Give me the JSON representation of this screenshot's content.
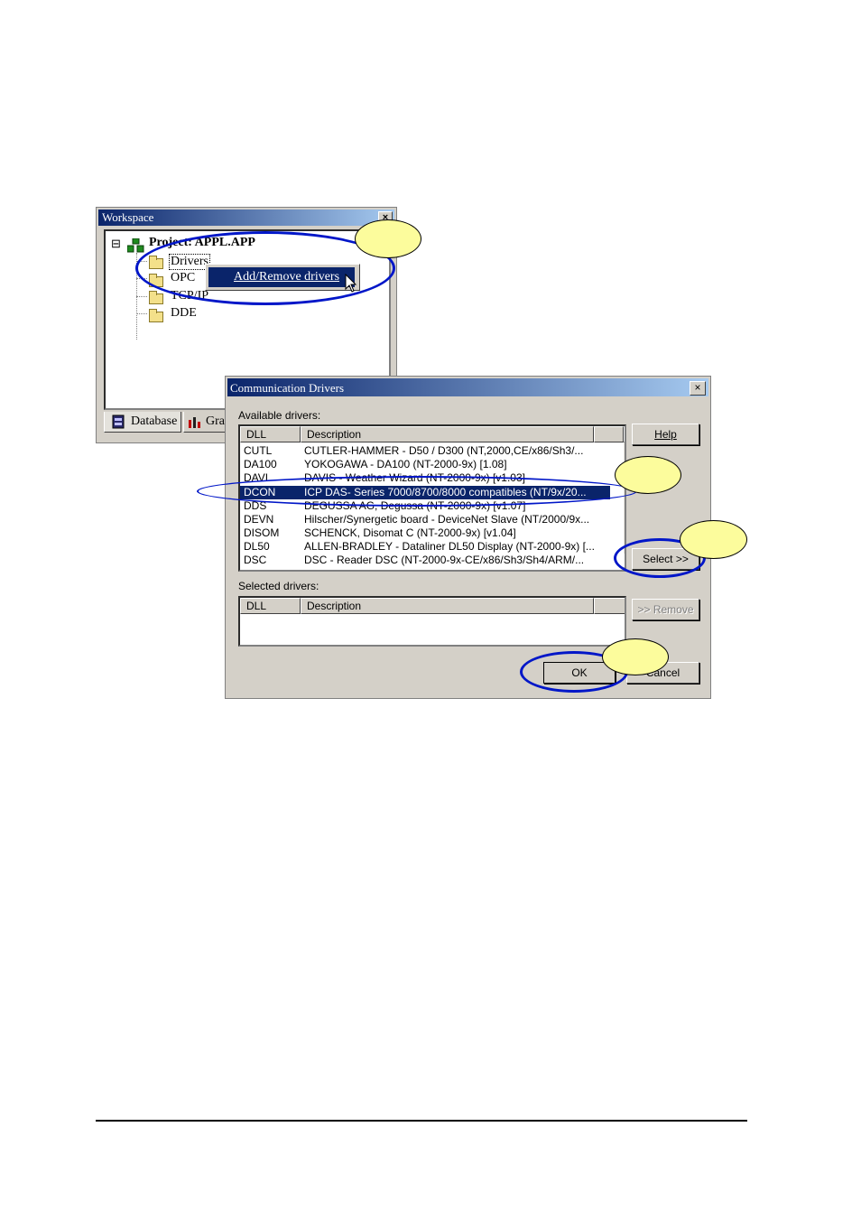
{
  "workspace": {
    "title": "Workspace",
    "close": "×",
    "tree": {
      "expander": "⊟",
      "project_label": "Project: APPL.APP",
      "items": [
        "Drivers",
        "OPC",
        "TCP/IP",
        "DDE"
      ]
    },
    "tabs": [
      "Database",
      "Gra"
    ]
  },
  "context_menu": {
    "item": "Add/Remove drivers"
  },
  "dialog": {
    "title": "Communication Drivers",
    "close": "×",
    "available_label": "Available drivers:",
    "selected_label": "Selected drivers:",
    "columns": {
      "dll": "DLL",
      "description": "Description"
    },
    "available_rows": [
      {
        "dll": "CUTL",
        "description": "CUTLER-HAMMER - D50 / D300 (NT,2000,CE/x86/Sh3/..."
      },
      {
        "dll": "DA100",
        "description": "YOKOGAWA - DA100 (NT-2000-9x) [1.08]"
      },
      {
        "dll": "DAVI",
        "description": "DAVIS - Weather Wizard (NT-2000-9x) [v1.03]"
      },
      {
        "dll": "DCON",
        "description": "ICP DAS- Series 7000/8700/8000 compatibles (NT/9x/20..."
      },
      {
        "dll": "DDS",
        "description": "DEGUSSA AG, Degussa (NT-2000-9x) [v1.07]"
      },
      {
        "dll": "DEVN",
        "description": "Hilscher/Synergetic board - DeviceNet Slave (NT/2000/9x..."
      },
      {
        "dll": "DISOM",
        "description": "SCHENCK, Disomat C (NT-2000-9x) [v1.04]"
      },
      {
        "dll": "DL50",
        "description": "ALLEN-BRADLEY - Dataliner DL50 Display (NT-2000-9x) [..."
      },
      {
        "dll": "DSC",
        "description": "DSC  - Reader DSC (NT-2000-9x-CE/x86/Sh3/Sh4/ARM/..."
      }
    ],
    "selected_row_index": 3,
    "buttons": {
      "help": "Help",
      "select": "Select >>",
      "remove": ">> Remove",
      "ok": "OK",
      "cancel": "Cancel"
    }
  },
  "colors": {
    "annotation_ellipse": "#0016c8",
    "annotation_bubble": "#fcfc9c",
    "titlebar_start": "#0a246a",
    "titlebar_end": "#a6caf0",
    "selection": "#0a246a"
  }
}
